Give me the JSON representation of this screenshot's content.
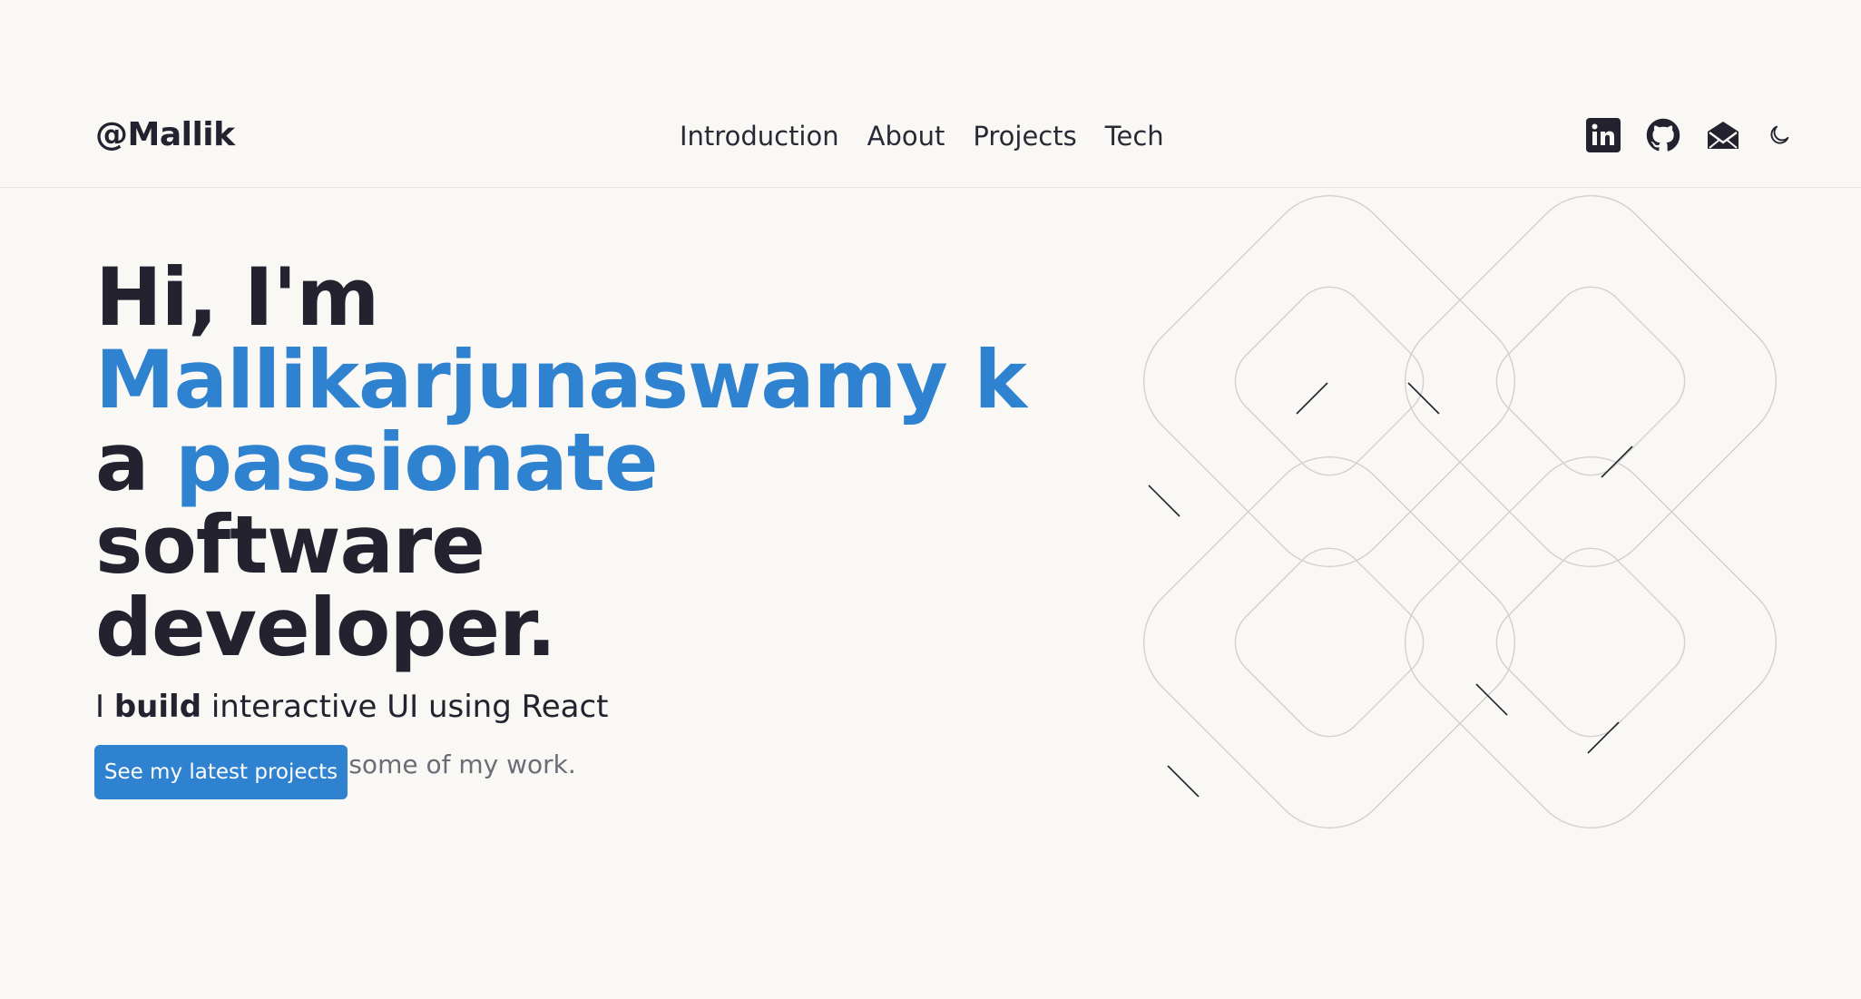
{
  "header": {
    "brand": "@Mallik",
    "nav": [
      "Introduction",
      "About",
      "Projects",
      "Tech"
    ],
    "icons": [
      "linkedin-icon",
      "github-icon",
      "mail-icon",
      "moon-icon"
    ]
  },
  "hero": {
    "line1": "Hi, I'm",
    "name": "Mallikarjunaswamy k",
    "line3_prefix": "a",
    "line3_accent": "passionate",
    "line3_suffix": "software",
    "line4": "developer.",
    "sub_i": "I",
    "sub_bold": "build",
    "sub_rest": "interactive UI using React",
    "sub2": "Stick around to see some of my work.",
    "cta": "See my latest projects"
  },
  "colors": {
    "background": "#faf8f5",
    "text": "#23222e",
    "accent": "#2e82d0",
    "muted": "#6b6c76"
  }
}
